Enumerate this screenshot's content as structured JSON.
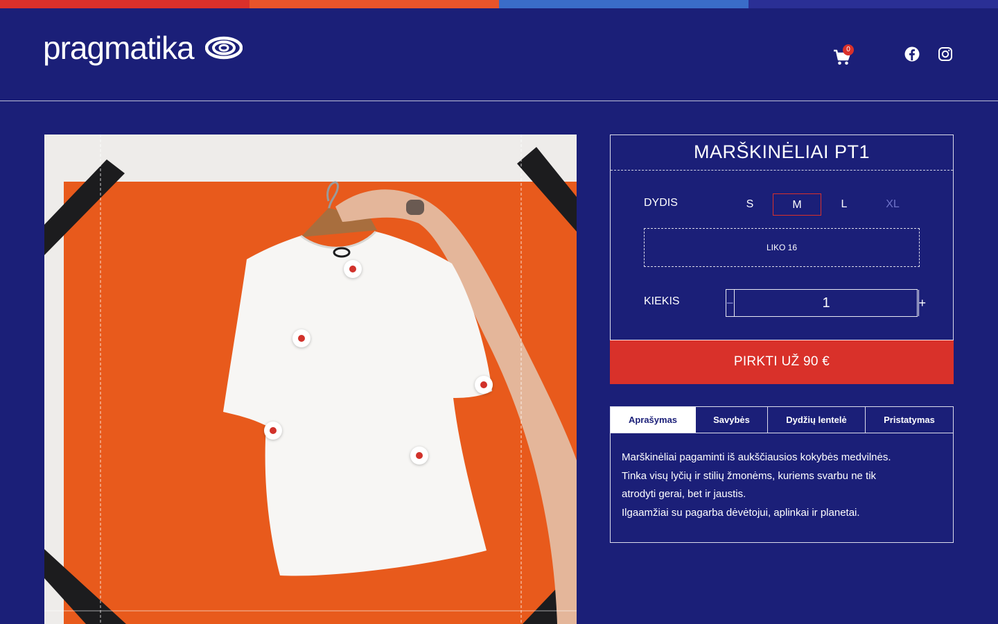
{
  "brand": {
    "name": "pragmatika",
    "icon": "eye-logo-icon"
  },
  "colors": {
    "background": "#1b1f78",
    "accent_red": "#d9312a",
    "stripe": [
      "#d9302a",
      "#e8542a",
      "#3a6cc8",
      "#2a2f95"
    ],
    "image_orange": "#e85a1c"
  },
  "header": {
    "cart": {
      "icon": "cart-icon",
      "count": "0"
    },
    "social": [
      {
        "icon": "facebook-icon"
      },
      {
        "icon": "instagram-icon"
      }
    ]
  },
  "product": {
    "title": "MARŠKINĖLIAI PT1",
    "size_label": "DYDIS",
    "sizes": [
      {
        "label": "S",
        "state": "available"
      },
      {
        "label": "M",
        "state": "selected"
      },
      {
        "label": "L",
        "state": "available"
      },
      {
        "label": "XL",
        "state": "unavailable"
      }
    ],
    "stock_text": "LIKO 16",
    "quantity_label": "KIEKIS",
    "quantity": "1",
    "minus": "−",
    "plus": "+",
    "buy_label": "PIRKTI UŽ 90 €",
    "hotspots_count": 5
  },
  "tabs": {
    "items": [
      "Aprašymas",
      "Savybės",
      "Dydžių lentelė",
      "Pristatymas"
    ],
    "active_index": 0,
    "content": [
      "Marškinėliai pagaminti iš aukščiausios kokybės medvilnės.",
      "Tinka visų lyčių ir stilių žmonėms, kuriems svarbu ne tik",
      "atrodyti gerai, bet ir jaustis.",
      "Ilgaamžiai su pagarba dėvėtojui, aplinkai ir planetai."
    ]
  }
}
